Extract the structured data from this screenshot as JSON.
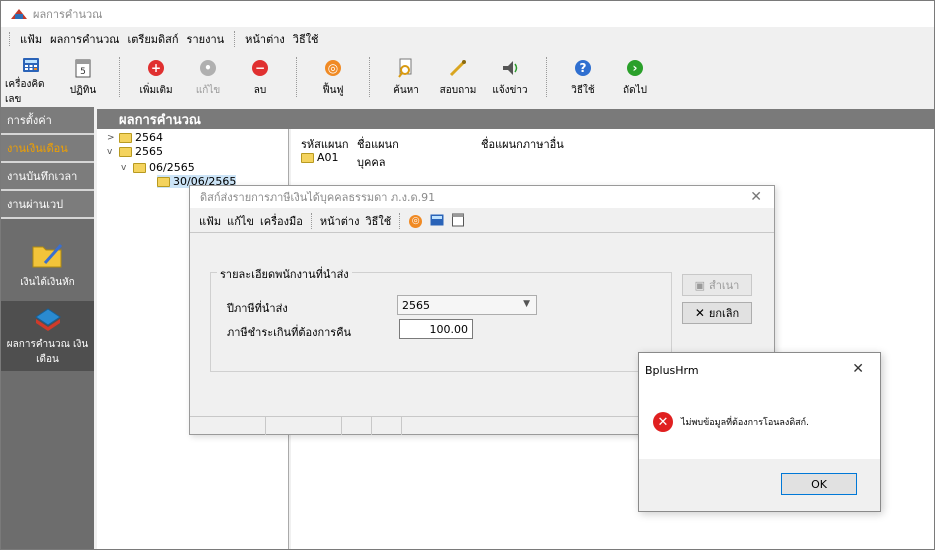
{
  "window": {
    "title": "ผลการคำนวณ"
  },
  "menu": [
    "แฟ้ม",
    "ผลการคำนวณ",
    "เตรียมดิสก์",
    "รายงาน",
    "หน้าต่าง",
    "วิธีใช้"
  ],
  "toolbar": [
    {
      "label": "เครื่องคิดเลข",
      "icon": "calculator-icon",
      "disabled": false
    },
    {
      "label": "ปฏิทิน",
      "icon": "calendar-icon",
      "disabled": false
    },
    {
      "label": "เพิ่มเติม",
      "icon": "add-icon",
      "disabled": false
    },
    {
      "label": "แก้ไข",
      "icon": "edit-icon",
      "disabled": true
    },
    {
      "label": "ลบ",
      "icon": "delete-icon",
      "disabled": false
    },
    {
      "label": "ฟื้นฟู",
      "icon": "refresh-icon",
      "disabled": false
    },
    {
      "label": "ค้นหา",
      "icon": "find-icon",
      "disabled": false
    },
    {
      "label": "สอบถาม",
      "icon": "query-icon",
      "disabled": false
    },
    {
      "label": "แจ้งข่าว",
      "icon": "announce-icon",
      "disabled": false
    },
    {
      "label": "วิธีใช้",
      "icon": "help-icon",
      "disabled": false
    },
    {
      "label": "ถัดไป",
      "icon": "next-icon",
      "disabled": false
    }
  ],
  "sidebar": {
    "items": [
      {
        "label": "การตั้งค่า",
        "active": false
      },
      {
        "label": "งานเงินเดือน",
        "active": true
      },
      {
        "label": "งานบันทึกเวลา",
        "active": false
      },
      {
        "label": "งานผ่านเวป",
        "active": false
      }
    ],
    "big": [
      {
        "label": "เงินได้เงินหัก"
      },
      {
        "label": "ผลการคำนวณ เงินเดือน"
      }
    ]
  },
  "content": {
    "header": "ผลการคำนวณ"
  },
  "tree": [
    {
      "label": "2564",
      "expander": ">"
    },
    {
      "label": "2565",
      "expander": "v"
    },
    {
      "label": "06/2565",
      "expander": "v"
    },
    {
      "label": "30/06/2565",
      "expander": ""
    }
  ],
  "list": {
    "columns": [
      "รหัสแผนก",
      "ชื่อแผนก",
      "ชื่อแผนกภาษาอื่น"
    ],
    "rows": [
      {
        "code": "A01",
        "name": "บุคคล"
      }
    ]
  },
  "dialog": {
    "title": "ดิสก์ส่งรายการภาษีเงินได้บุคคลธรรมดา ภ.ง.ด.91",
    "menu": [
      "แฟ้ม",
      "แก้ไข",
      "เครื่องมือ",
      "หน้าต่าง",
      "วิธีใช้"
    ],
    "group_title": "รายละเอียดพนักงานที่นำส่ง",
    "year_label": "ปีภาษีที่นำส่ง",
    "year_value": "2565",
    "refund_label": "ภาษีชำระเกินที่ต้องการคืน",
    "refund_value": "100.00",
    "copy_button": "สำเนา",
    "cancel_button": "ยกเลิก"
  },
  "msgbox": {
    "title": "BplusHrm",
    "message": "ไม่พบข้อมูลที่ต้องการโอนลงดิสก์.",
    "ok": "OK"
  },
  "colors": {
    "sidebar_bg": "#6d6d6d",
    "header_bg": "#7a7a7a",
    "active_orange": "#f0a000",
    "error_red": "#e02020",
    "folder_yellow": "#f4d35e"
  }
}
